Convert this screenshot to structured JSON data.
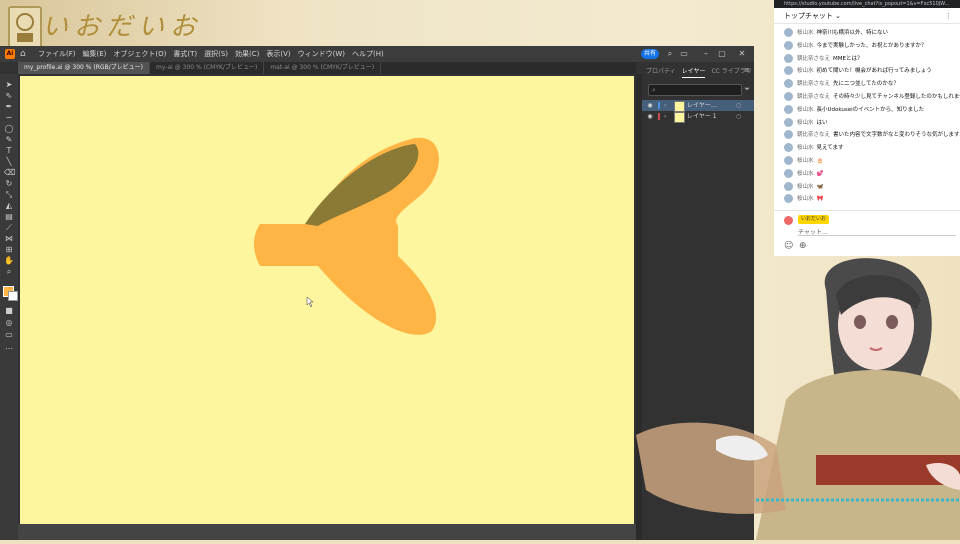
{
  "stream": {
    "title_deco": "いおだいお"
  },
  "illustrator": {
    "app_icon": "Ai",
    "menus": [
      "ファイル(F)",
      "編集(E)",
      "オブジェクト(O)",
      "書式(T)",
      "選択(S)",
      "効果(C)",
      "表示(V)",
      "ウィンドウ(W)",
      "ヘルプ(H)"
    ],
    "share_label": "共有",
    "tabs": [
      "my_profile.ai @ 300 % (RGB/プレビュー)",
      "my-ai @ 300 % (CMYK/プレビュー)",
      "mat-ai @ 300 % (CMYK/プレビュー)"
    ],
    "panel_tabs": [
      "プロパティ",
      "レイヤー",
      "CC ライブラリ"
    ],
    "layers": [
      {
        "name": "レイヤー…",
        "color": "#4a90e2"
      },
      {
        "name": "レイヤー 1",
        "color": "#c84e4e"
      }
    ],
    "colors": {
      "artboard": "#fef69e",
      "shape_fill": "#ffb545",
      "shape_shadow": "#8a7a35"
    }
  },
  "chat": {
    "url": "https://studio.youtube.com/live_chat?is_popout=1&v=Fxc510jW...",
    "header": "トップチャット",
    "messages": [
      {
        "author": "桜山水",
        "text": "神奈川も横浜以外、特にない"
      },
      {
        "author": "桜山水",
        "text": "今まで実験しかった、お祝とかありますか？"
      },
      {
        "author": "朝比奈さなえ",
        "text": "MMEとは？"
      },
      {
        "author": "桜山水",
        "text": "初めて聞いた！機会があれば行ってみましょう"
      },
      {
        "author": "朝比奈さなえ",
        "text": "先に二つ並してたのかな？"
      },
      {
        "author": "朝比奈さなえ",
        "text": "その時々少し見てチャンネル登録したのかもしれません"
      },
      {
        "author": "桜山水",
        "text": "長小Udokuseiのイベントから、知りました"
      },
      {
        "author": "桜山水",
        "text": "はい"
      },
      {
        "author": "朝比奈さなえ",
        "text": "書いた内容で文字数がなと変わりそうな気がします"
      },
      {
        "author": "桜山水",
        "text": "見えてます"
      },
      {
        "author": "桜山水",
        "text": "🎂"
      },
      {
        "author": "桜山水",
        "text": "💕"
      },
      {
        "author": "桜山水",
        "text": "🦋"
      },
      {
        "author": "桜山水",
        "text": "🎀"
      }
    ],
    "input_name": "いおだいお",
    "input_placeholder": "チャット..."
  }
}
